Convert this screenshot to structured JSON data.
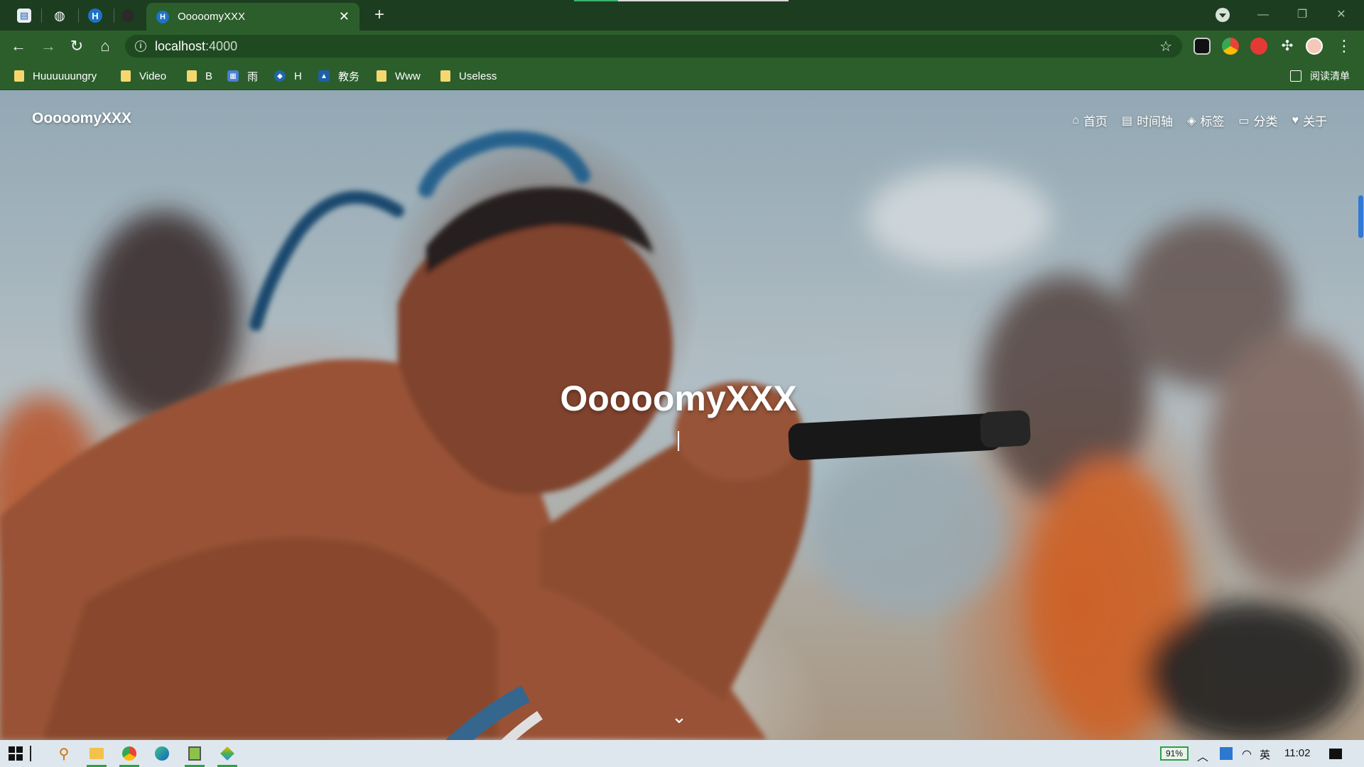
{
  "browser": {
    "tabs": {
      "pinned": [
        {
          "icon": "doc-favicon"
        },
        {
          "icon": "globe-favicon"
        },
        {
          "icon": "h-favicon",
          "letter": "H"
        },
        {
          "icon": "github-favicon"
        }
      ],
      "active": {
        "title": "OoooomyXXX",
        "icon": "h-favicon",
        "letter": "H"
      },
      "new_tab_label": "+"
    },
    "window_controls": {
      "minimize": "—",
      "restore": "❐",
      "close": "✕"
    },
    "address": {
      "host": "localhost",
      "port": ":4000"
    },
    "bookmarks": [
      {
        "label": "Huuuuuungry",
        "type": "folder"
      },
      {
        "label": "Video",
        "type": "folder"
      },
      {
        "label": "B",
        "type": "folder"
      },
      {
        "label": "雨",
        "type": "site"
      },
      {
        "label": "H",
        "type": "site"
      },
      {
        "label": "教务",
        "type": "site"
      },
      {
        "label": "Www",
        "type": "folder"
      },
      {
        "label": "Useless",
        "type": "folder"
      }
    ],
    "reading_list": "阅读清单"
  },
  "site": {
    "brand": "OoooomyXXX",
    "menu": [
      {
        "label": "首页",
        "icon": "home-icon"
      },
      {
        "label": "时间轴",
        "icon": "archive-icon"
      },
      {
        "label": "标签",
        "icon": "tags-icon"
      },
      {
        "label": "分类",
        "icon": "folder-open-icon"
      },
      {
        "label": "关于",
        "icon": "heart-icon"
      }
    ],
    "hero_title": "OoooomyXXX"
  },
  "taskbar": {
    "battery": "91%",
    "ime": "英",
    "time": "11:02"
  },
  "colors": {
    "tab_strip": "#1c3d1f",
    "toolbar": "#2b5e2b",
    "accent": "#2ea043"
  }
}
